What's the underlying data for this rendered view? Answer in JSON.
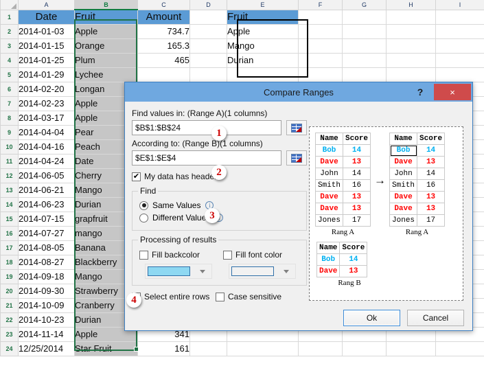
{
  "spreadsheet": {
    "columns": [
      "A",
      "B",
      "C",
      "D",
      "E",
      "F",
      "G",
      "H",
      "I"
    ],
    "selected_column": "B",
    "headers": {
      "a": "Date",
      "b": "Fruit",
      "c": "Amount",
      "e": "Fruit"
    },
    "rows": [
      {
        "n": "1",
        "a": "Date",
        "b": "Fruit",
        "c": "Amount",
        "e": "Fruit"
      },
      {
        "n": "2",
        "a": "2014-01-03",
        "b": "Apple",
        "c": "734.7",
        "e": "Apple"
      },
      {
        "n": "3",
        "a": "2014-01-15",
        "b": "Orange",
        "c": "165.3",
        "e": "Mango"
      },
      {
        "n": "4",
        "a": "2014-01-25",
        "b": "Plum",
        "c": "465",
        "e": "Durian"
      },
      {
        "n": "5",
        "a": "2014-01-29",
        "b": "Lychee",
        "c": "",
        "e": ""
      },
      {
        "n": "6",
        "a": "2014-02-20",
        "b": "Longan",
        "c": "",
        "e": ""
      },
      {
        "n": "7",
        "a": "2014-02-23",
        "b": "Apple",
        "c": "",
        "e": ""
      },
      {
        "n": "8",
        "a": "2014-03-17",
        "b": "Apple",
        "c": "",
        "e": ""
      },
      {
        "n": "9",
        "a": "2014-04-04",
        "b": "Pear",
        "c": "",
        "e": ""
      },
      {
        "n": "10",
        "a": "2014-04-16",
        "b": "Peach",
        "c": "",
        "e": ""
      },
      {
        "n": "11",
        "a": "2014-04-24",
        "b": "Date",
        "c": "",
        "e": ""
      },
      {
        "n": "12",
        "a": "2014-06-05",
        "b": "Cherry",
        "c": "",
        "e": ""
      },
      {
        "n": "13",
        "a": "2014-06-21",
        "b": "Mango",
        "c": "",
        "e": ""
      },
      {
        "n": "14",
        "a": "2014-06-23",
        "b": "Durian",
        "c": "",
        "e": ""
      },
      {
        "n": "15",
        "a": "2014-07-15",
        "b": "grapfruit",
        "c": "",
        "e": ""
      },
      {
        "n": "16",
        "a": "2014-07-27",
        "b": "mango",
        "c": "",
        "e": ""
      },
      {
        "n": "17",
        "a": "2014-08-05",
        "b": "Banana",
        "c": "",
        "e": ""
      },
      {
        "n": "18",
        "a": "2014-08-27",
        "b": "Blackberry",
        "c": "",
        "e": ""
      },
      {
        "n": "19",
        "a": "2014-09-18",
        "b": "Mango",
        "c": "",
        "e": ""
      },
      {
        "n": "20",
        "a": "2014-09-30",
        "b": "Strawberry",
        "c": "",
        "e": ""
      },
      {
        "n": "21",
        "a": "2014-10-09",
        "b": "Cranberry",
        "c": "",
        "e": ""
      },
      {
        "n": "22",
        "a": "2014-10-23",
        "b": "Durian",
        "c": "",
        "e": ""
      },
      {
        "n": "23",
        "a": "2014-11-14",
        "b": "Apple",
        "c": "341",
        "e": ""
      },
      {
        "n": "24",
        "a": "12/25/2014",
        "b": "Star Fruit",
        "c": "161",
        "e": ""
      }
    ]
  },
  "dialog": {
    "title": "Compare Ranges",
    "help_glyph": "?",
    "close_glyph": "×",
    "range_a": {
      "label": "Find values in: (Range A)(1 columns)",
      "value": "$B$1:$B$24"
    },
    "range_b": {
      "label": "According to: (Range B)(1 columns)",
      "value": "$E$1:$E$4"
    },
    "has_headers": {
      "label": "My data has headers",
      "checked": true,
      "mark": "✔"
    },
    "find": {
      "legend": "Find",
      "same": {
        "label": "Same Values",
        "selected": true
      },
      "different": {
        "label": "Different Values",
        "selected": false
      },
      "info_glyph": "i"
    },
    "processing": {
      "legend": "Processing of results",
      "fill_backcolor": {
        "label": "Fill backcolor",
        "checked": false
      },
      "fill_fontcolor": {
        "label": "Fill font color",
        "checked": false
      },
      "back_swatch": "#8ed8f2",
      "font_swatch": "#f2f2f2"
    },
    "select_entire_rows": {
      "label": "Select entire rows",
      "checked": true,
      "mark": "✔"
    },
    "case_sensitive": {
      "label": "Case sensitive",
      "checked": false
    },
    "ok_label": "Ok",
    "cancel_label": "Cancel",
    "badges": [
      "1",
      "2",
      "3",
      "4"
    ],
    "preview": {
      "arrow": "→",
      "caption_a_left": "Rang A",
      "caption_a_right": "Rang A",
      "caption_b": "Rang B",
      "header": [
        "Name",
        "Score"
      ],
      "range_a_before": [
        {
          "name": "Bob",
          "score": "14",
          "style": "blue"
        },
        {
          "name": "Dave",
          "score": "13",
          "style": "red"
        },
        {
          "name": "John",
          "score": "14",
          "style": "plain"
        },
        {
          "name": "Smith",
          "score": "16",
          "style": "plain"
        },
        {
          "name": "Dave",
          "score": "13",
          "style": "red"
        },
        {
          "name": "Dave",
          "score": "13",
          "style": "red"
        },
        {
          "name": "Jones",
          "score": "17",
          "style": "plain"
        }
      ],
      "range_a_after": [
        {
          "name": "Bob",
          "score": "14",
          "style": "blue",
          "highlight": true,
          "active": true
        },
        {
          "name": "Dave",
          "score": "13",
          "style": "red",
          "highlight": true,
          "active": false
        },
        {
          "name": "John",
          "score": "14",
          "style": "plain",
          "highlight": false,
          "active": false
        },
        {
          "name": "Smith",
          "score": "16",
          "style": "plain",
          "highlight": false,
          "active": false
        },
        {
          "name": "Dave",
          "score": "13",
          "style": "red",
          "highlight": true,
          "active": false
        },
        {
          "name": "Dave",
          "score": "13",
          "style": "red",
          "highlight": true,
          "active": false
        },
        {
          "name": "Jones",
          "score": "17",
          "style": "plain",
          "highlight": false,
          "active": false
        }
      ],
      "range_b": [
        {
          "name": "Bob",
          "score": "14",
          "style": "blue"
        },
        {
          "name": "Dave",
          "score": "13",
          "style": "red"
        }
      ]
    }
  }
}
